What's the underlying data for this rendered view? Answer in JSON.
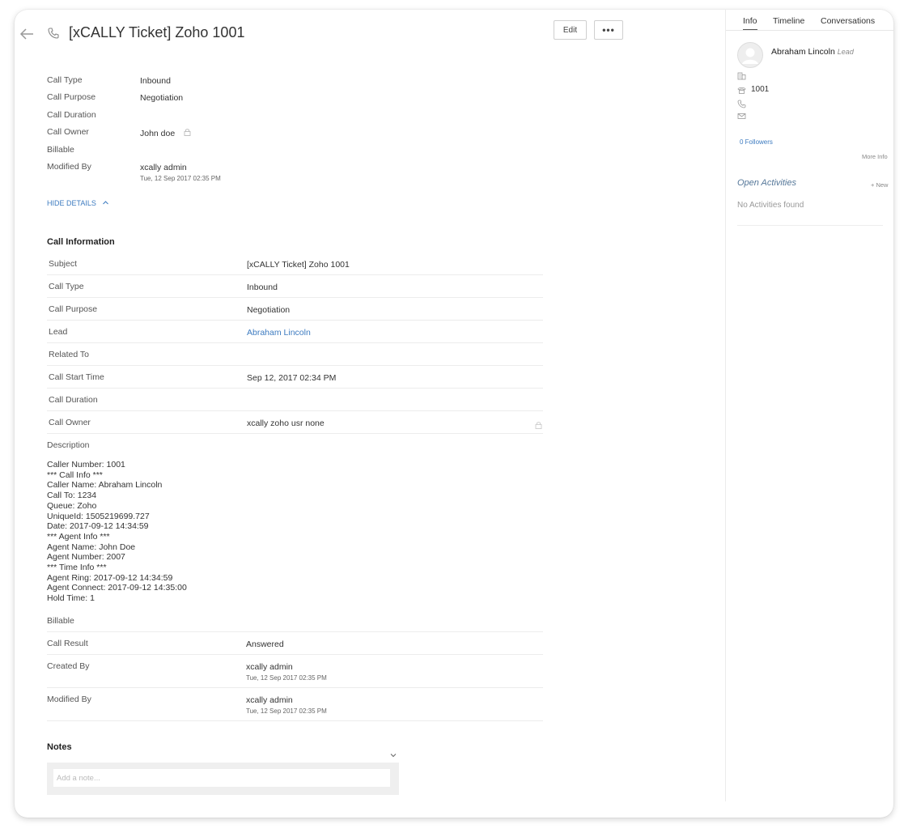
{
  "header": {
    "title": "[xCALLY Ticket] Zoho 1001",
    "edit_label": "Edit",
    "more_label": "•••"
  },
  "summary": {
    "call_type_label": "Call Type",
    "call_type_value": "Inbound",
    "call_purpose_label": "Call Purpose",
    "call_purpose_value": "Negotiation",
    "call_duration_label": "Call Duration",
    "call_owner_label": "Call Owner",
    "call_owner_value": "John doe",
    "billable_label": "Billable",
    "modified_by_label": "Modified By",
    "modified_by_value": "xcally admin",
    "modified_by_time": "Tue, 12 Sep 2017 02:35 PM",
    "hide_details": "HIDE DETAILS"
  },
  "call_information": {
    "title": "Call Information",
    "rows": [
      {
        "label": "Subject",
        "value": "[xCALLY Ticket] Zoho 1001"
      },
      {
        "label": "Call Type",
        "value": "Inbound"
      },
      {
        "label": "Call Purpose",
        "value": "Negotiation"
      },
      {
        "label": "Lead",
        "value": "Abraham Lincoln"
      },
      {
        "label": "Related To",
        "value": ""
      },
      {
        "label": "Call Start Time",
        "value": "Sep 12, 2017 02:34 PM"
      },
      {
        "label": "Call Duration",
        "value": ""
      },
      {
        "label": "Call Owner",
        "value": "xcally zoho usr none"
      }
    ],
    "description_label": "Description",
    "description_lines": [
      "Caller Number: 1001",
      "*** Call Info ***",
      "Caller Name: Abraham Lincoln",
      "Call To: 1234",
      "Queue: Zoho",
      "UniqueId: 1505219699.727",
      "Date: 2017-09-12 14:34:59",
      "*** Agent Info ***",
      "Agent Name: John Doe",
      "Agent Number: 2007",
      "*** Time Info ***",
      "Agent Ring: 2017-09-12 14:34:59",
      "Agent Connect: 2017-09-12 14:35:00",
      "Hold Time: 1"
    ],
    "billable_label": "Billable",
    "call_result_label": "Call Result",
    "call_result_value": "Answered",
    "created_by_label": "Created By",
    "created_by_value": "xcally admin",
    "created_by_time": "Tue, 12 Sep 2017 02:35 PM",
    "modified_by_label": "Modified By",
    "modified_by_value": "xcally admin",
    "modified_by_time": "Tue, 12 Sep 2017 02:35 PM"
  },
  "notes": {
    "title": "Notes",
    "placeholder": "Add a note..."
  },
  "sidebar": {
    "tabs": [
      "Info",
      "Timeline",
      "Conversations"
    ],
    "active_tab": "Info",
    "contact_name": "Abraham Lincoln",
    "contact_role": "Lead",
    "phone": "1001",
    "followers": "0 Followers",
    "more_info": "More Info",
    "open_activities": "Open Activities",
    "new_label": "+ New",
    "no_activities": "No Activities found"
  },
  "icons": [
    "back-arrow-icon",
    "phone-icon",
    "lock-icon",
    "chevron-up-icon",
    "chevron-down-icon",
    "avatar-icon",
    "building-icon",
    "telephone-icon",
    "mobile-phone-icon",
    "mail-icon"
  ],
  "colors": {
    "link": "#3d7bc0",
    "border": "#ececec",
    "text": "#333333"
  }
}
